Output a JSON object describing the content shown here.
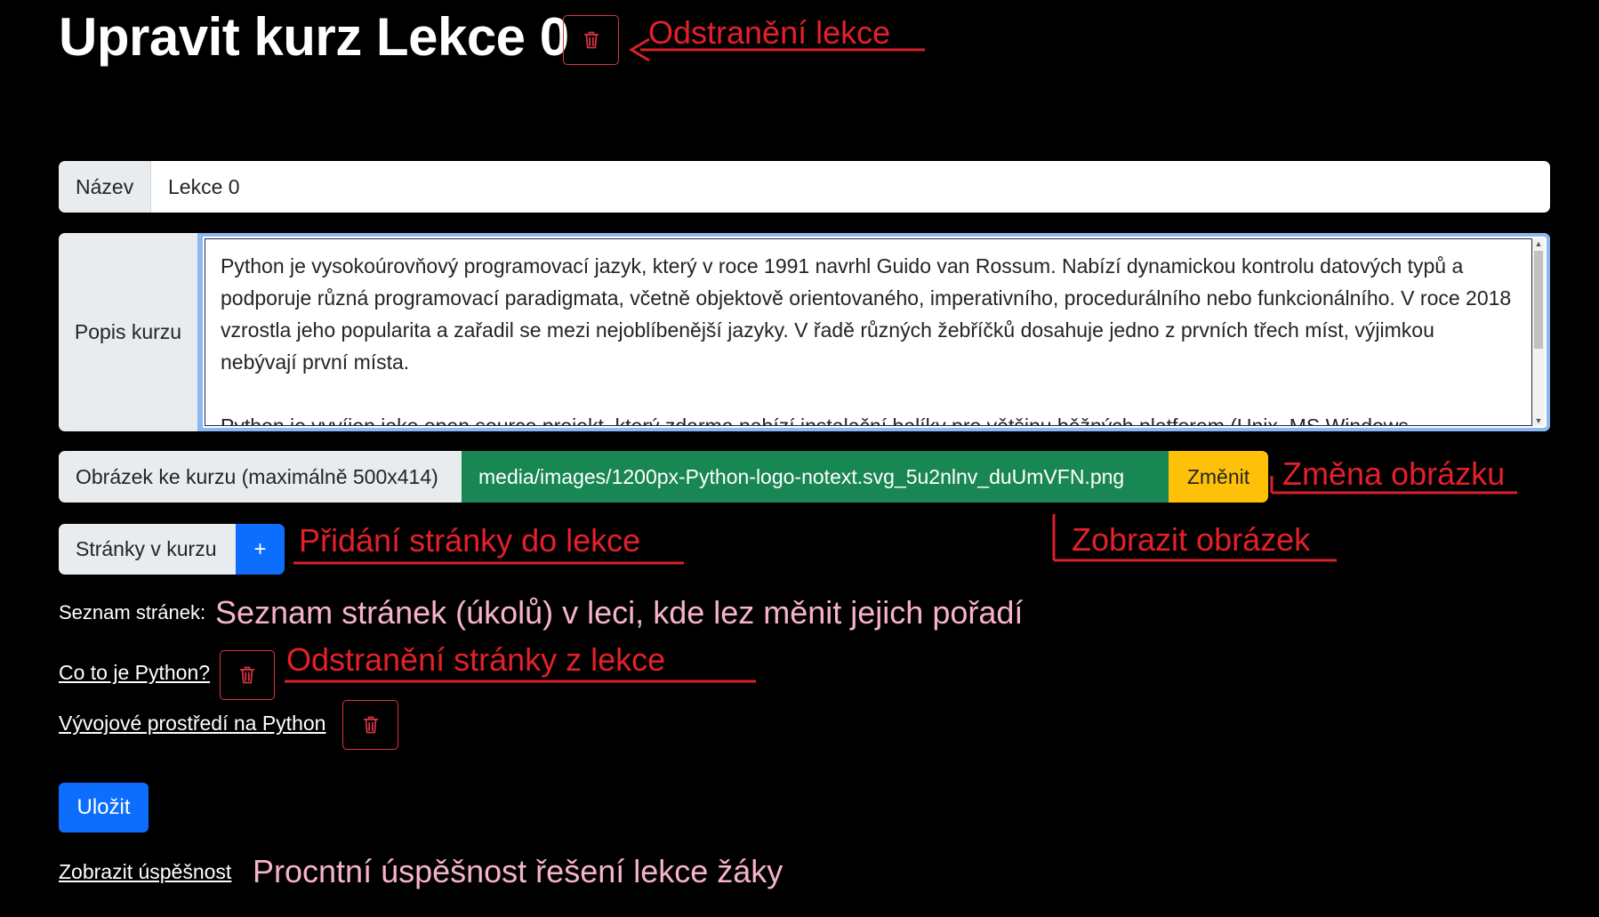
{
  "header": {
    "title": "Upravit kurz Lekce 0"
  },
  "form": {
    "name_label": "Název",
    "name_value": "Lekce 0",
    "desc_label": "Popis kurzu",
    "desc_value": "Python je vysokoúrovňový programovací jazyk, který v roce 1991 navrhl Guido van Rossum. Nabízí dynamickou kontrolu datových typů a podporuje různá programovací paradigmata, včetně objektově orientovaného, imperativního, procedurálního nebo funkcionálního. V roce 2018 vzrostla jeho popularita a zařadil se mezi nejoblíbenější jazyky. V řadě různých žebříčků dosahuje jedno z prvních třech míst, výjimkou nebývají první místa.\n\nPython je vyvíjen jako open source projekt, který zdarma nabízí instalační balíky pro většinu běžných platforem (Unix, MS Windows,",
    "image_label": "Obrázek ke kurzu (maximálně 500x414)",
    "image_file": "media/images/1200px-Python-logo-notext.svg_5u2nlnv_duUmVFN.png",
    "image_change": "Změnit",
    "pages_label": "Stránky v kurzu",
    "pages_add": "+",
    "pages_list_label": "Seznam stránek:",
    "pages": [
      {
        "title": "Co to je Python?"
      },
      {
        "title": "Vývojové prostředí na Python"
      }
    ],
    "save_label": "Uložit",
    "success_link": "Zobrazit úspěšnost"
  },
  "annotations": {
    "delete_lesson": "Odstranění lekce",
    "change_image": "Změna obrázku",
    "show_image": "Zobrazit obrázek",
    "add_page": "Přidání stránky do lekce",
    "pages_list": "Seznam stránek (úkolů) v leci, kde lez měnit jejich pořadí",
    "delete_page": "Odstranění stránky z lekce",
    "success": "Procntní úspěšnost řešení lekce žáky"
  },
  "icons": {
    "delete": "trash-icon",
    "add": "plus-icon"
  },
  "colors": {
    "background": "#000000",
    "primary": "#0d6efd",
    "success": "#198754",
    "warning": "#ffc107",
    "danger": "#dc3545",
    "annotation_red": "#e4202a",
    "annotation_pink": "#f7b3c8"
  }
}
